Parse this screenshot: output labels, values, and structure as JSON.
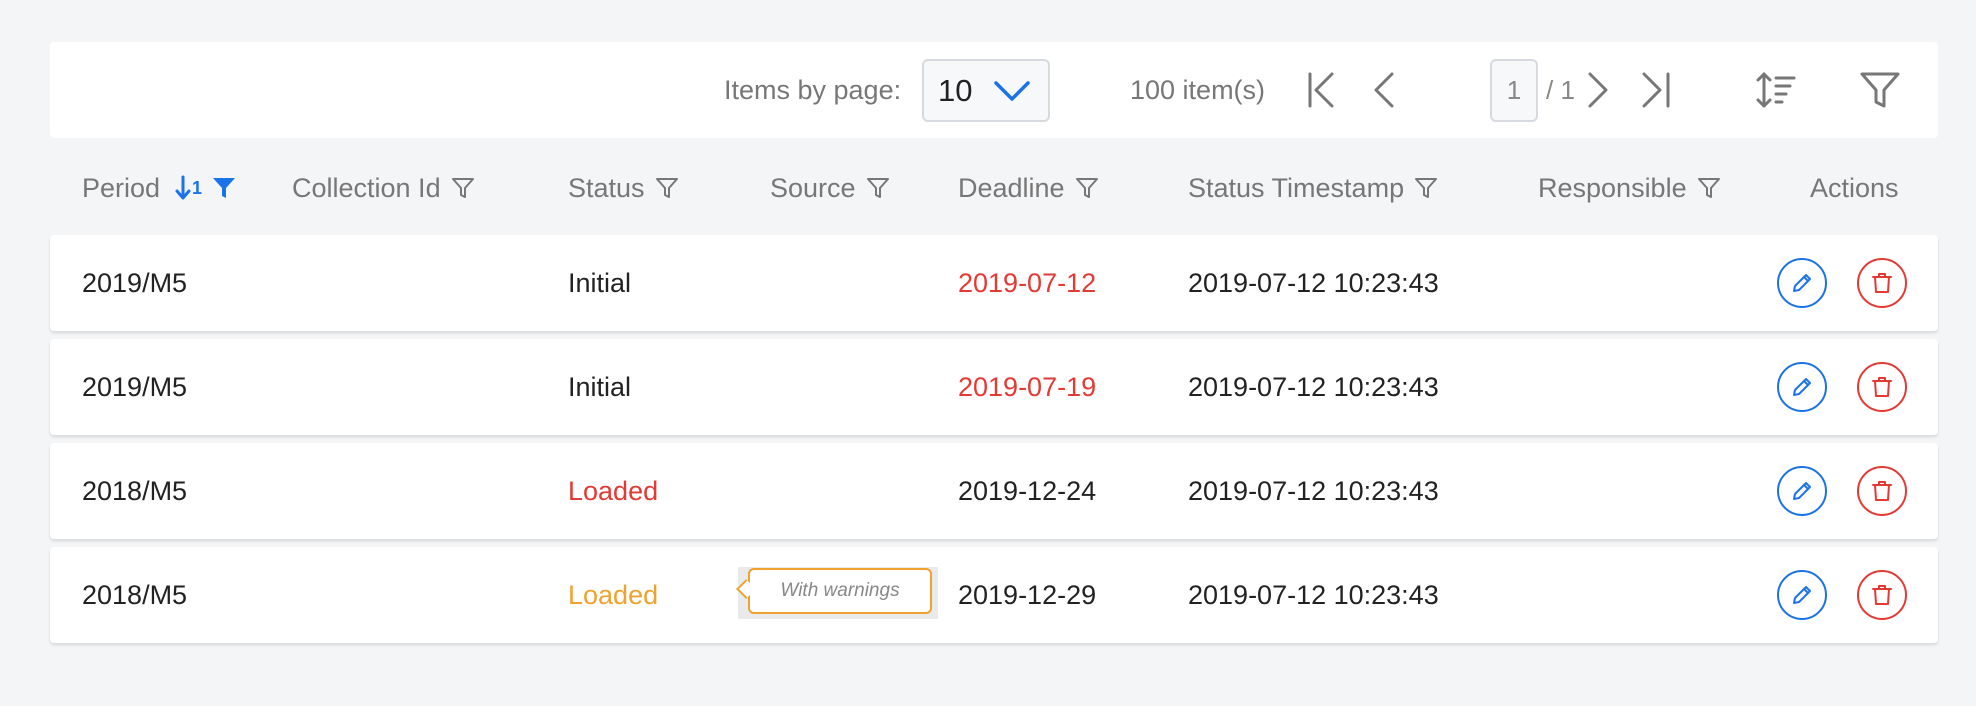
{
  "toolbar": {
    "items_by_page_label": "Items by page:",
    "items_by_page_value": "10",
    "item_count": "100 item(s)",
    "current_page": "1",
    "total_pages": "/ 1"
  },
  "columns": {
    "period": "Period",
    "period_sort_index": "1",
    "collection_id": "Collection Id",
    "status": "Status",
    "source": "Source",
    "deadline": "Deadline",
    "status_timestamp": "Status Timestamp",
    "responsible": "Responsible",
    "actions": "Actions"
  },
  "rows": [
    {
      "period": "2019/M5",
      "collection_id": "",
      "status": "Initial",
      "source": "",
      "deadline": "2019-07-12",
      "status_timestamp": "2019-07-12 10:23:43",
      "responsible": ""
    },
    {
      "period": "2019/M5",
      "collection_id": "",
      "status": "Initial",
      "source": "",
      "deadline": "2019-07-19",
      "status_timestamp": "2019-07-12 10:23:43",
      "responsible": ""
    },
    {
      "period": "2018/M5",
      "collection_id": "",
      "status": "Loaded",
      "source": "",
      "deadline": "2019-12-24",
      "status_timestamp": "2019-07-12 10:23:43",
      "responsible": ""
    },
    {
      "period": "2018/M5",
      "collection_id": "",
      "status": "Loaded",
      "source": "",
      "deadline": "2019-12-29",
      "status_timestamp": "2019-07-12 10:23:43",
      "responsible": "",
      "status_tooltip": "With warnings"
    }
  ],
  "colors": {
    "accent": "#1a73e8",
    "danger": "#e53935",
    "warning": "#f0a22e",
    "muted": "#777777"
  },
  "icons": {
    "first_page": "first-page-icon",
    "prev_page": "prev-page-icon",
    "next_page": "next-page-icon",
    "last_page": "last-page-icon",
    "row_density": "row-density-icon",
    "filter": "filter-icon",
    "edit": "pencil-icon",
    "delete": "trash-icon"
  }
}
